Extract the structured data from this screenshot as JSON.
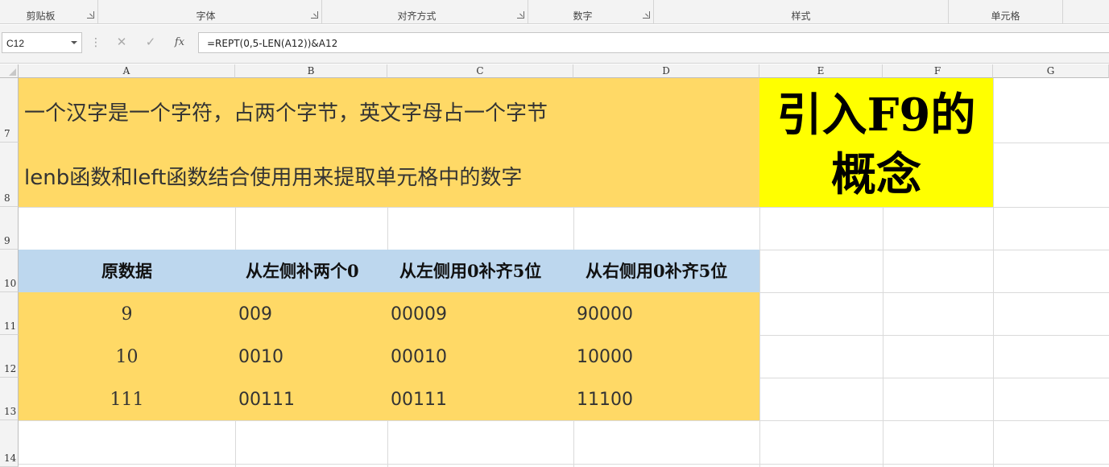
{
  "ribbon": {
    "groups": [
      {
        "label": "剪贴板"
      },
      {
        "label": "字体"
      },
      {
        "label": "对齐方式"
      },
      {
        "label": "数字"
      },
      {
        "label": "样式"
      },
      {
        "label": "单元格"
      }
    ]
  },
  "formula_bar": {
    "name_box": "C12",
    "cancel_icon": "✕",
    "enter_icon": "✓",
    "fx_label": "fx",
    "formula": "=REPT(0,5-LEN(A12))&A12"
  },
  "columns": [
    "A",
    "B",
    "C",
    "D",
    "E",
    "F",
    "G"
  ],
  "rows": [
    "7",
    "8",
    "9",
    "10",
    "11",
    "12",
    "13",
    "14"
  ],
  "notes": {
    "line1": "一个汉字是一个字符，占两个字节，英文字母占一个字节",
    "line2": "lenb函数和left函数结合使用用来提取单元格中的数字"
  },
  "banner": {
    "line1": "引入F9的",
    "line2": "概念"
  },
  "table": {
    "headers": [
      "原数据",
      "从左侧补两个0",
      "从左侧用0补齐5位",
      "从右侧用0补齐5位"
    ],
    "rows": [
      [
        "9",
        "009",
        "00009",
        "90000"
      ],
      [
        "10",
        "0010",
        "00010",
        "10000"
      ],
      [
        "111",
        "00111",
        "00111",
        "11100"
      ]
    ]
  },
  "colors": {
    "orange_fill": "#ffd966",
    "blue_fill": "#bdd7ee",
    "yellow_fill": "#ffff00"
  }
}
